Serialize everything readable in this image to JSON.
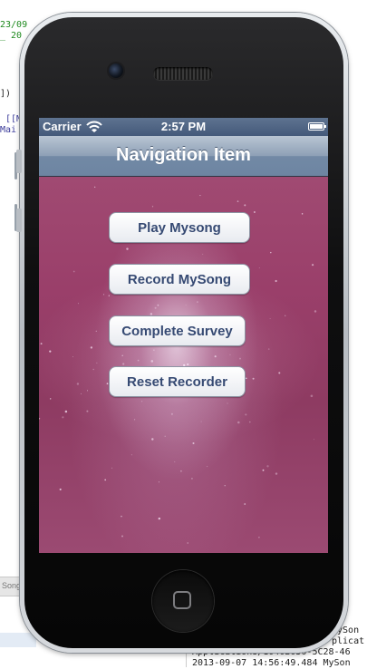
{
  "editor": {
    "lines": [
      "23/09",
      "_ 20",
      "])",
      "[[M",
      "Mai"
    ],
    "bottom_tab": "Song"
  },
  "console": {
    "lines": [
      "MySon",
      "plicat",
      "Applications/1040B050-5C28-46",
      "2013-09-07 14:56:49.484 MySon"
    ]
  },
  "status_bar": {
    "carrier": "Carrier",
    "time": "2:57 PM",
    "wifi_icon": "wifi-icon",
    "battery_icon": "battery-icon",
    "battery_level": 1.0
  },
  "nav": {
    "title": "Navigation Item"
  },
  "buttons": [
    {
      "label": "Play Mysong"
    },
    {
      "label": "Record MySong"
    },
    {
      "label": "Complete Survey"
    },
    {
      "label": "Reset Recorder"
    }
  ],
  "colors": {
    "status_bar": "#4f6484",
    "nav_bar": "#8ea0b6",
    "button_text": "#364a73",
    "content_background": "#9a3f6a"
  }
}
